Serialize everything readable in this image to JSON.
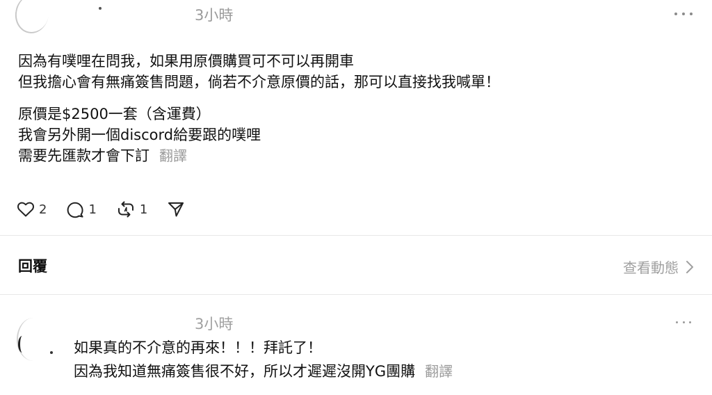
{
  "post": {
    "timestamp": "3小時",
    "paragraphs": [
      [
        "因為有噗哩在問我，如果用原價購買可不可以再開車",
        "但我擔心會有無痛簽售問題，倘若不介意原價的話，那可以直接找我喊單！"
      ],
      [
        "原價是$2500一套（含運費）",
        "我會另外開一個discord給要跟的噗哩",
        "需要先匯款才會下訂"
      ]
    ],
    "translate_label": "翻譯",
    "actions": {
      "like_count": "2",
      "comment_count": "1",
      "repost_count": "1"
    }
  },
  "reply_bar": {
    "title": "回覆",
    "view_activity": "查看動態"
  },
  "reply": {
    "timestamp": "3小時",
    "lines": [
      "如果真的不介意的再來！！！拜託了！",
      "因為我知道無痛簽售很不好，所以才遲遲沒開YG團購"
    ],
    "translate_label": "翻譯"
  },
  "icons": {
    "like": "heart-icon",
    "comment": "comment-icon",
    "repost": "repost-icon",
    "share": "send-icon",
    "more": "more-icon",
    "chevron": "chevron-right-icon"
  }
}
